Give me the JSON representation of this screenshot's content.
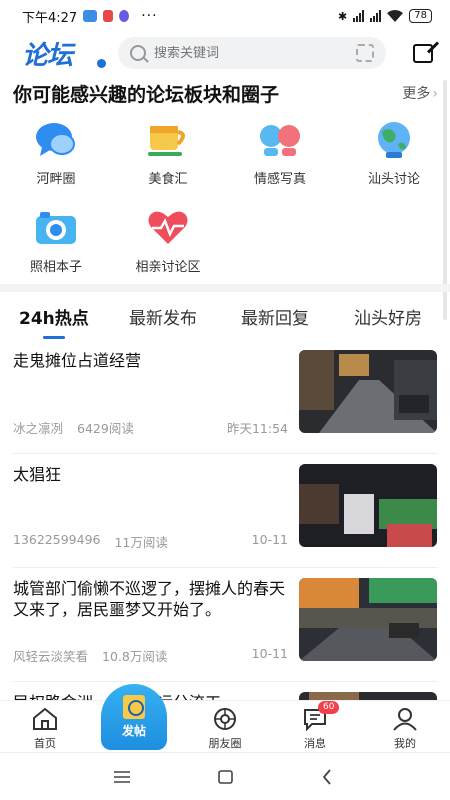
{
  "status_bar": {
    "time": "下午4:27",
    "more": "···",
    "battery": "78"
  },
  "header": {
    "logo": "论坛",
    "search_placeholder": "搜索关键词"
  },
  "section": {
    "title": "你可能感兴趣的论坛板块和圈子",
    "more": "更多"
  },
  "forums": [
    {
      "label": "河畔圈",
      "icon": "chat-bubble-icon"
    },
    {
      "label": "美食汇",
      "icon": "cup-icon"
    },
    {
      "label": "情感写真",
      "icon": "couple-icon"
    },
    {
      "label": "汕头讨论",
      "icon": "globe-icon"
    },
    {
      "label": "照相本子",
      "icon": "camera-icon"
    },
    {
      "label": "相亲讨论区",
      "icon": "heart-icon"
    }
  ],
  "tabs": [
    "24h热点",
    "最新发布",
    "最新回复",
    "汕头好房"
  ],
  "posts": [
    {
      "title": "走鬼摊位占道经营",
      "author": "冰之凛冽",
      "views": "6429阅读",
      "date": "昨天11:54"
    },
    {
      "title": "太猖狂",
      "author": "13622599496",
      "views": "11万阅读",
      "date": "10-11"
    },
    {
      "title": "城管部门偷懒不巡逻了，摆摊人的春天又来了，居民噩梦又开始了。",
      "author": "风轻云淡笑看",
      "views": "10.8万阅读",
      "date": "10-11"
    },
    {
      "title": "民权路金洲……南国运分流工",
      "author": "",
      "views": "",
      "date": ""
    }
  ],
  "bottom_nav": {
    "home": "首页",
    "post": "发帖",
    "friends": "朋友圈",
    "messages": "消息",
    "messages_badge": "60",
    "mine": "我的"
  },
  "colors": {
    "accent": "#1f6fd6",
    "badge": "#f2414b",
    "post_button": "#1e8ee0"
  }
}
